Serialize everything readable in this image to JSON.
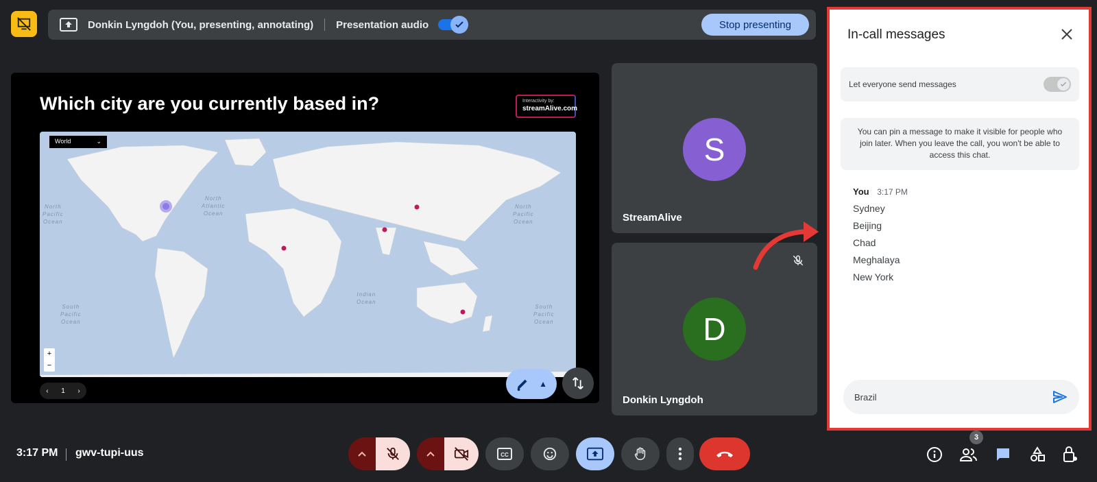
{
  "top_bar": {
    "presenter_label": "Donkin Lyngdoh (You, presenting, annotating)",
    "audio_label": "Presentation audio",
    "audio_enabled": true,
    "stop_label": "Stop presenting"
  },
  "presentation": {
    "title": "Which city are you currently based in?",
    "badge_line1": "Interactivity by:",
    "badge_line2": "streamAlive.com",
    "map_select": "World",
    "oceans": {
      "north_pacific_left": "North\nPacific\nOcean",
      "north_atlantic": "North\nAtlantic\nOcean",
      "north_pacific_right": "North\nPacific\nOcean",
      "south_pacific_left": "South\nPacific\nOcean",
      "indian": "Indian\nOcean",
      "south_pacific_right": "South\nPacific\nOcean"
    },
    "page_number": "1",
    "zoom_in": "+",
    "zoom_out": "−"
  },
  "participants": [
    {
      "initial": "S",
      "name": "StreamAlive",
      "color": "#8660d2"
    },
    {
      "initial": "D",
      "name": "Donkin Lyngdoh",
      "color": "#2a6e1f",
      "muted": true
    }
  ],
  "chat": {
    "title": "In-call messages",
    "permission_label": "Let everyone send messages",
    "permission_enabled": true,
    "info_text": "You can pin a message to make it visible for people who join later. When you leave the call, you won't be able to access this chat.",
    "sender": "You",
    "time": "3:17 PM",
    "messages": [
      "Sydney",
      "Beijing",
      "Chad",
      "Meghalaya",
      "New York"
    ],
    "input_value": "Brazil"
  },
  "bottom_bar": {
    "time": "3:17 PM",
    "meeting_code": "gwv-tupi-uus",
    "people_count": "3"
  },
  "colors": {
    "accent": "#a8c7fa",
    "end_call": "#dc362e",
    "highlight_border": "#e53935",
    "map_marker": "#c2185b"
  }
}
